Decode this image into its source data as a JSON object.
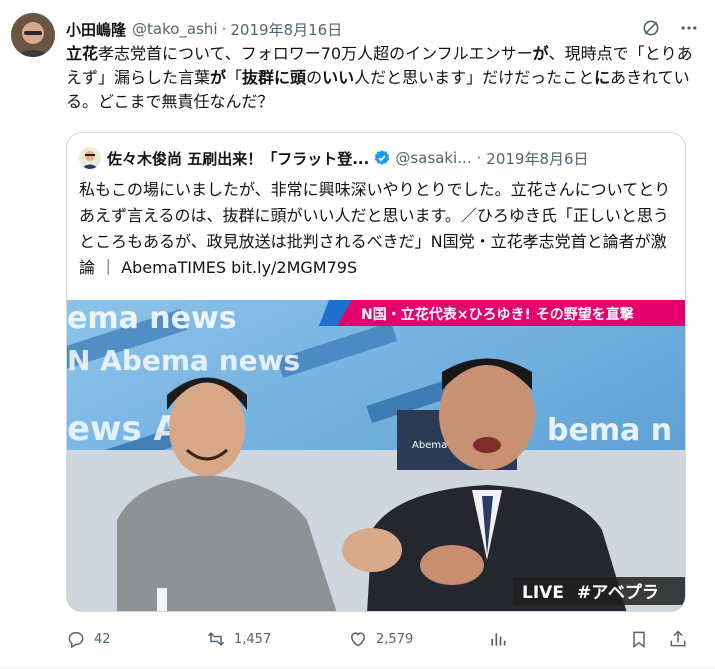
{
  "tweet": {
    "author_name": "小田嶋隆",
    "author_handle": "@tako_ashi",
    "separator": "·",
    "date": "2019年8月16日",
    "text_segments": [
      {
        "text": "立花",
        "bold": true
      },
      {
        "text": "孝志党首について、フォロワー70万人超のインフルエンサー",
        "bold": false
      },
      {
        "text": "が",
        "bold": true
      },
      {
        "text": "、現時点で「とりあえず」漏らした言葉",
        "bold": false
      },
      {
        "text": "が",
        "bold": true
      },
      {
        "text": "「",
        "bold": false
      },
      {
        "text": "抜群に頭",
        "bold": true
      },
      {
        "text": "の",
        "bold": false
      },
      {
        "text": "いい",
        "bold": true
      },
      {
        "text": "人だと思います」だけだったこと",
        "bold": false
      },
      {
        "text": "に",
        "bold": true
      },
      {
        "text": "あきれている。どこまで無責任なんだ？",
        "bold": false
      }
    ]
  },
  "quote": {
    "author_name": "佐々木俊尚 五刷出来！「フラット登...",
    "author_handle": "@sasaki...",
    "separator": "·",
    "date": "2019年8月6日",
    "text": "私もこの場にいましたが、非常に興味深いやりとりでした。立花さんについてとりあえず言えるのは、抜群に頭がいい人だと思います。／ひろゆき氏「正しいと思うところもあるが、政見放送は批判されるべきだ」N国党・立花孝志党首と論者が激論 ｜ AbemaTIMES bit.ly/2MGM79S",
    "media": {
      "banner_text": "N国・立花代表×ひろゆき! その野望を直撃",
      "bg_text_1": "ema news",
      "bg_text_2": "N Abema news",
      "bg_text_3": "ews A",
      "bg_text_4": "bema n",
      "live_label": "LIVE",
      "hashtag": "#アベプラ",
      "desk_label": "Abema Prime"
    }
  },
  "actions": {
    "replies": "42",
    "retweets": "1,457",
    "likes": "2,579"
  },
  "icons": {
    "grok": "slash-circle-icon",
    "more": "more-dots-icon",
    "reply": "reply-icon",
    "retweet": "retweet-icon",
    "like": "heart-icon",
    "views": "bar-chart-icon",
    "bookmark": "bookmark-icon",
    "share": "share-icon",
    "verified": "verified-badge-icon"
  },
  "colors": {
    "text": "#0f1419",
    "secondary": "#536471",
    "verified": "#1d9bf0",
    "banner": "#e5006e"
  }
}
